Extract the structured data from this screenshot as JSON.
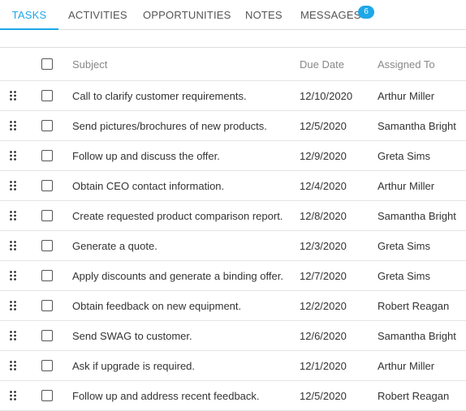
{
  "tabs": [
    {
      "label": "TASKS",
      "active": true
    },
    {
      "label": "ACTIVITIES",
      "active": false
    },
    {
      "label": "OPPORTUNITIES",
      "active": false
    },
    {
      "label": "NOTES",
      "active": false
    },
    {
      "label": "MESSAGES",
      "active": false,
      "badge": "6"
    }
  ],
  "colors": {
    "accent": "#1ea7e8",
    "text": "#333333",
    "header_text": "#888888"
  },
  "grid": {
    "columns": {
      "subject": "Subject",
      "due_date": "Due Date",
      "assigned_to": "Assigned To"
    },
    "rows": [
      {
        "subject": "Call to clarify customer requirements.",
        "due_date": "12/10/2020",
        "assigned_to": "Arthur Miller"
      },
      {
        "subject": "Send pictures/brochures of new products.",
        "due_date": "12/5/2020",
        "assigned_to": "Samantha Bright"
      },
      {
        "subject": "Follow up and discuss the offer.",
        "due_date": "12/9/2020",
        "assigned_to": "Greta Sims"
      },
      {
        "subject": "Obtain CEO contact information.",
        "due_date": "12/4/2020",
        "assigned_to": "Arthur Miller"
      },
      {
        "subject": "Create requested product comparison report.",
        "due_date": "12/8/2020",
        "assigned_to": "Samantha Bright"
      },
      {
        "subject": "Generate a quote.",
        "due_date": "12/3/2020",
        "assigned_to": "Greta Sims"
      },
      {
        "subject": "Apply discounts and generate a binding offer.",
        "due_date": "12/7/2020",
        "assigned_to": "Greta Sims"
      },
      {
        "subject": "Obtain feedback on new equipment.",
        "due_date": "12/2/2020",
        "assigned_to": "Robert Reagan"
      },
      {
        "subject": "Send SWAG to customer.",
        "due_date": "12/6/2020",
        "assigned_to": "Samantha Bright"
      },
      {
        "subject": "Ask if upgrade is required.",
        "due_date": "12/1/2020",
        "assigned_to": "Arthur Miller"
      },
      {
        "subject": "Follow up and address recent feedback.",
        "due_date": "12/5/2020",
        "assigned_to": "Robert Reagan"
      }
    ]
  },
  "icons": {
    "drag_handle": "drag-handle-icon",
    "checkbox": "checkbox-unchecked"
  }
}
